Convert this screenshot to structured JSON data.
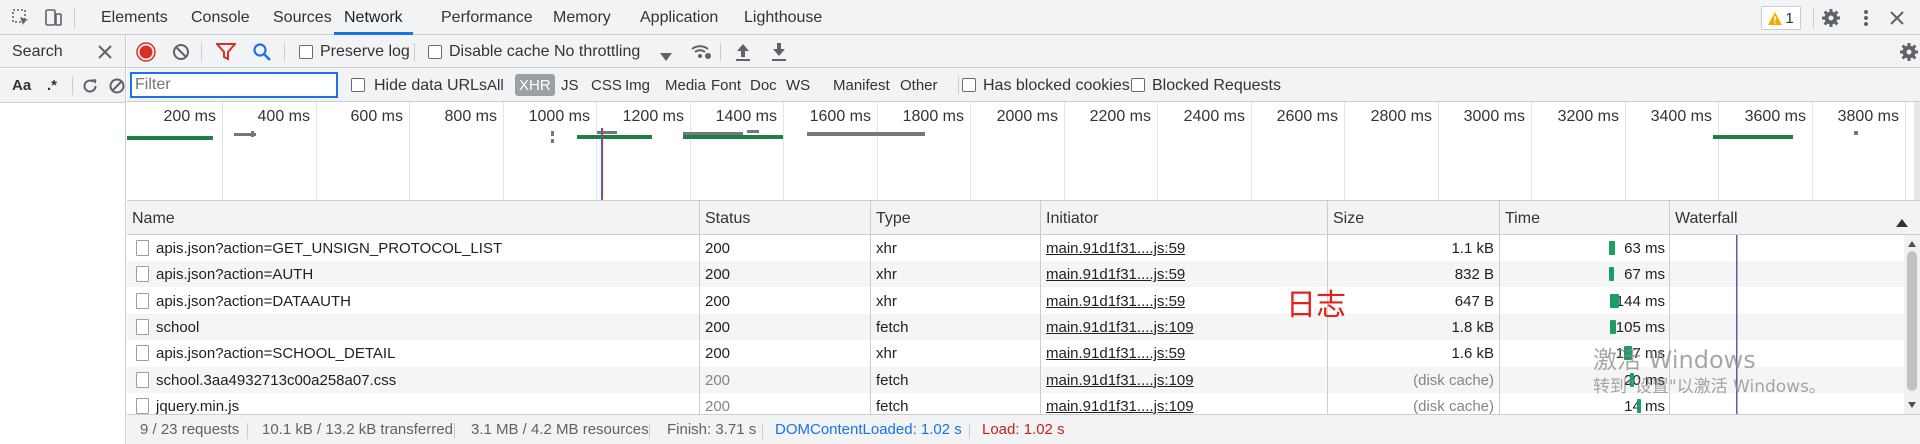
{
  "tabs": [
    "Elements",
    "Console",
    "Sources",
    "Network",
    "Performance",
    "Memory",
    "Application",
    "Lighthouse"
  ],
  "warning_count": "1",
  "search": {
    "title": "Search",
    "case_label": "Aa",
    "regex_label": ".*"
  },
  "toolbar": {
    "preserve_log": "Preserve log",
    "disable_cache": "Disable cache",
    "throttling": "No throttling"
  },
  "filter": {
    "placeholder": "Filter",
    "hide_data_urls": "Hide data URLs",
    "types": [
      "All",
      "XHR",
      "JS",
      "CSS",
      "Img",
      "Media",
      "Font",
      "Doc",
      "WS",
      "Manifest",
      "Other"
    ],
    "active_type": "XHR",
    "has_blocked_cookies": "Has blocked cookies",
    "blocked_requests": "Blocked Requests"
  },
  "overview": {
    "ticks": [
      "200 ms",
      "400 ms",
      "600 ms",
      "800 ms",
      "1000 ms",
      "1200 ms",
      "1400 ms",
      "1600 ms",
      "1800 ms",
      "2000 ms",
      "2200 ms",
      "2400 ms",
      "2600 ms",
      "2800 ms",
      "3000 ms",
      "3200 ms",
      "3400 ms",
      "3600 ms",
      "3800 ms"
    ]
  },
  "table": {
    "columns": [
      "Name",
      "Status",
      "Type",
      "Initiator",
      "Size",
      "Time",
      "Waterfall"
    ],
    "rows": [
      {
        "name": "apis.json?action=GET_UNSIGN_PROTOCOL_LIST",
        "status": "200",
        "type": "xhr",
        "initiator": "main.91d1f31....js:59",
        "size": "1.1 kB",
        "time": "63 ms"
      },
      {
        "name": "apis.json?action=AUTH",
        "status": "200",
        "type": "xhr",
        "initiator": "main.91d1f31....js:59",
        "size": "832 B",
        "time": "67 ms"
      },
      {
        "name": "apis.json?action=DATAAUTH",
        "status": "200",
        "type": "xhr",
        "initiator": "main.91d1f31....js:59",
        "size": "647 B",
        "time": "144 ms"
      },
      {
        "name": "school",
        "status": "200",
        "type": "fetch",
        "initiator": "main.91d1f31....js:109",
        "size": "1.8 kB",
        "time": "105 ms"
      },
      {
        "name": "apis.json?action=SCHOOL_DETAIL",
        "status": "200",
        "type": "xhr",
        "initiator": "main.91d1f31....js:59",
        "size": "1.6 kB",
        "time": "177 ms"
      },
      {
        "name": "school.3aa4932713c00a258a07.css",
        "status": "200",
        "type": "fetch",
        "initiator": "main.91d1f31....js:109",
        "size": "(disk cache)",
        "time": "20 ms"
      },
      {
        "name": "jquery.min.js",
        "status": "200",
        "type": "fetch",
        "initiator": "main.91d1f31....js:109",
        "size": "(disk cache)",
        "time": "14 ms"
      }
    ]
  },
  "overlay": {
    "annotation": "日志",
    "watermark_line1": "激活 Windows",
    "watermark_line2": "转到\"设置\"以激活 Windows。"
  },
  "status": {
    "requests": "9 / 23 requests",
    "transferred": "10.1 kB / 13.2 kB transferred",
    "resources": "3.1 MB / 4.2 MB resources",
    "finish": "Finish: 3.71 s",
    "dcl": "DOMContentLoaded: 1.02 s",
    "load": "Load: 1.02 s"
  },
  "colors": {
    "accent": "#1a73e8",
    "record": "#d93025",
    "filter": "#d93025",
    "load": "#c5221f",
    "waterfall": "#1a9e61"
  }
}
